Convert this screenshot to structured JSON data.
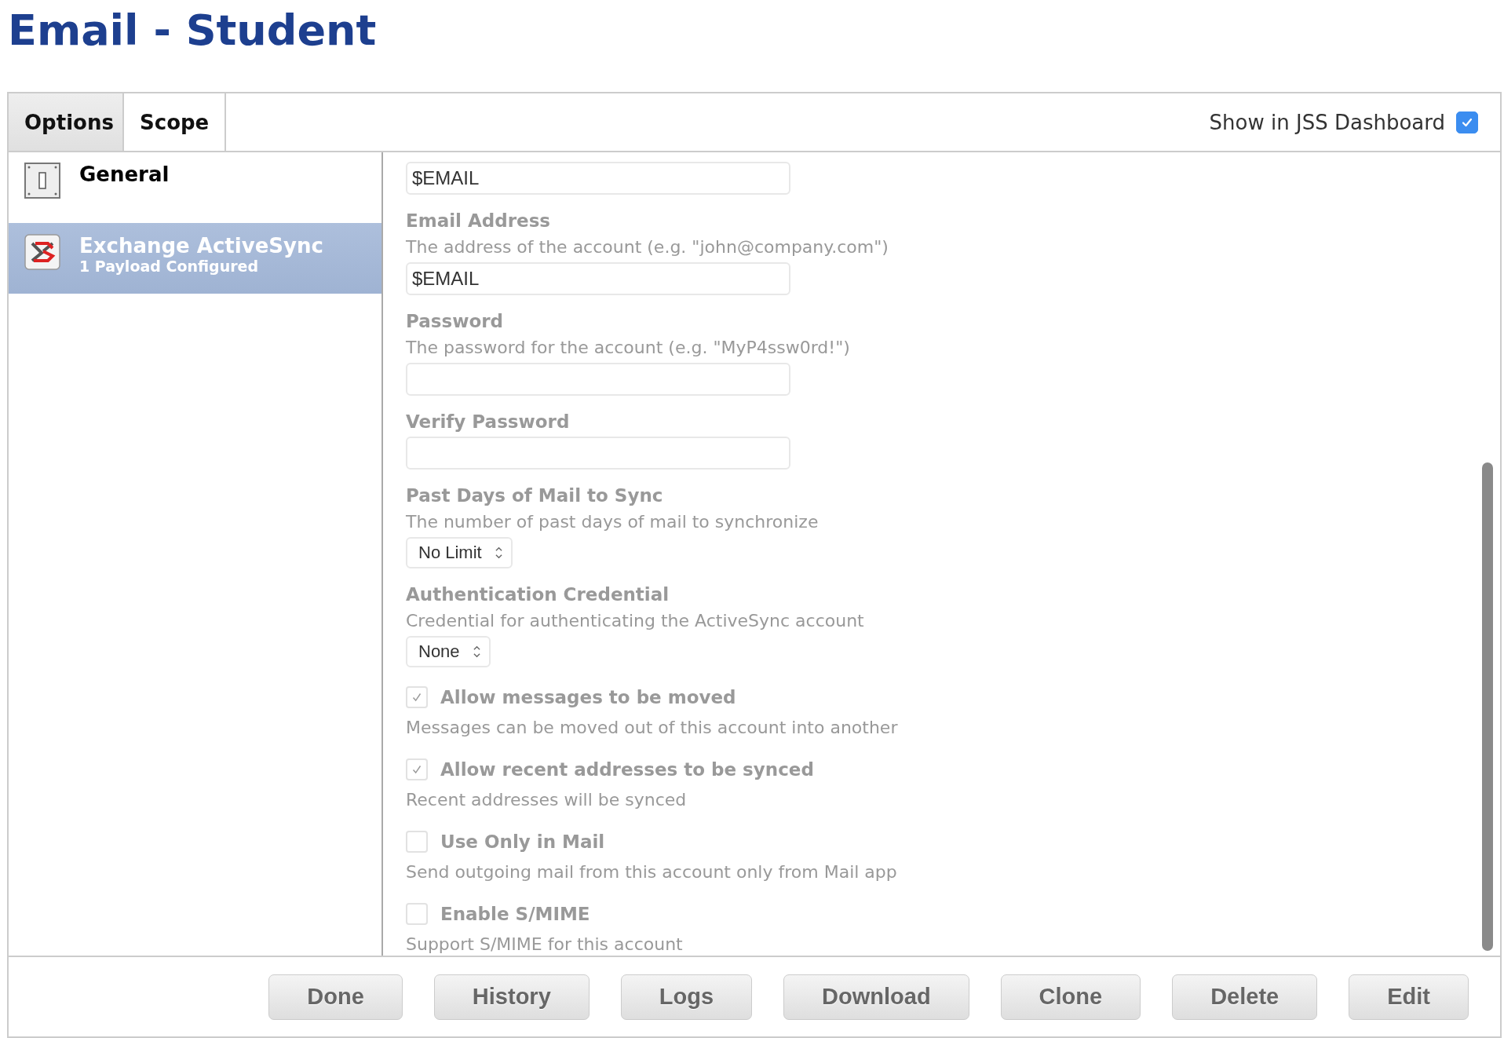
{
  "page_title": "Email - Student",
  "tabs": [
    {
      "label": "Options",
      "selected": true
    },
    {
      "label": "Scope",
      "selected": false
    }
  ],
  "dashboard_toggle": {
    "label": "Show in JSS Dashboard",
    "checked": true
  },
  "sidebar": {
    "items": [
      {
        "kind": "switch",
        "title": "General",
        "selected": false
      },
      {
        "kind": "exchange",
        "title": "Exchange ActiveSync",
        "subtitle": "1 Payload Configured",
        "selected": true
      }
    ]
  },
  "form": [
    {
      "kind": "text",
      "value": "$EMAIL"
    },
    {
      "kind": "text",
      "label": "Email Address",
      "description": "The address of the account (e.g. \"john@company.com\")",
      "value": "$EMAIL"
    },
    {
      "kind": "text",
      "label": "Password",
      "description": "The password for the account (e.g. \"MyP4ssw0rd!\")"
    },
    {
      "kind": "text",
      "label": "Verify Password"
    },
    {
      "kind": "select",
      "label": "Past Days of Mail to Sync",
      "description": "The number of past days of mail to synchronize",
      "value": "No Limit"
    },
    {
      "kind": "select",
      "label": "Authentication Credential",
      "description": "Credential for authenticating the ActiveSync account",
      "value": "None"
    },
    {
      "kind": "checkbox",
      "label": "Allow messages to be moved",
      "description": "Messages can be moved out of this account into another",
      "checked": true
    },
    {
      "kind": "checkbox",
      "label": "Allow recent addresses to be synced",
      "description": "Recent addresses will be synced",
      "checked": true
    },
    {
      "kind": "checkbox",
      "label": "Use Only in Mail",
      "description": "Send outgoing mail from this account only from Mail app",
      "checked": false
    },
    {
      "kind": "checkbox",
      "label": "Enable S/MIME",
      "description": "Support S/MIME for this account",
      "checked": false
    }
  ],
  "buttons": [
    "Done",
    "History",
    "Logs",
    "Download",
    "Clone",
    "Delete",
    "Edit"
  ]
}
